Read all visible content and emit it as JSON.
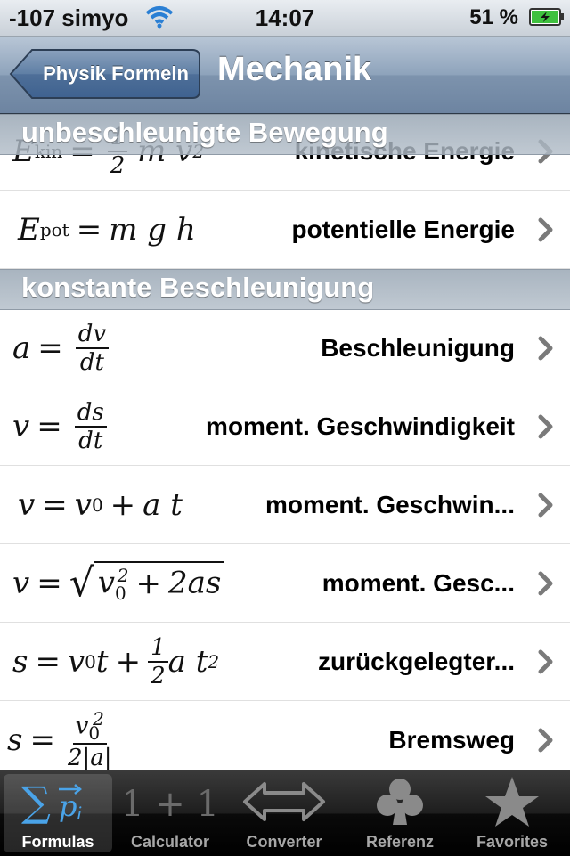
{
  "status_bar": {
    "carrier": "-107 simyo",
    "time": "14:07",
    "battery": "51 %"
  },
  "nav": {
    "back_label": "Physik Formeln",
    "title": "Mechanik"
  },
  "sections": [
    {
      "title": "unbeschleunigte Bewegung"
    },
    {
      "title": "konstante Beschleunigung"
    }
  ],
  "rows": [
    {
      "label": "kinetische Energie"
    },
    {
      "label": "potentielle Energie"
    },
    {
      "label": "Beschleunigung"
    },
    {
      "label": "moment. Geschwindigkeit"
    },
    {
      "label": "moment. Geschwin..."
    },
    {
      "label": "moment. Gesc..."
    },
    {
      "label": "zurückgelegter..."
    },
    {
      "label": "Bremsweg"
    }
  ],
  "tabs": [
    {
      "label": "Formulas",
      "icon": "sum-vector-icon",
      "active": true
    },
    {
      "label": "Calculator",
      "icon": "one-plus-one-icon",
      "active": false
    },
    {
      "label": "Converter",
      "icon": "double-arrow-icon",
      "active": false
    },
    {
      "label": "Referenz",
      "icon": "club-icon",
      "active": false
    },
    {
      "label": "Favorites",
      "icon": "star-icon",
      "active": false
    }
  ],
  "colors": {
    "nav_tint": "#6d84a1",
    "section_header": "#a3afbc",
    "active_tab_icon": "#4aa3e8"
  }
}
